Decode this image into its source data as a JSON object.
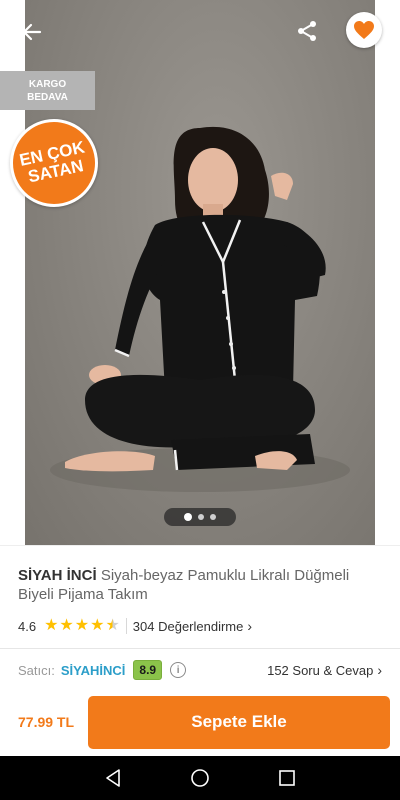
{
  "hero": {
    "cargo_badge": [
      "KARGO",
      "BEDAVA"
    ],
    "best_badge": [
      "EN ÇOK",
      "SATAN"
    ],
    "icons": [
      "back-arrow-icon",
      "share-icon",
      "heart-icon"
    ],
    "carousel": {
      "pages": 3,
      "active": 1
    }
  },
  "product": {
    "brand": "SİYAH İNCİ",
    "name": "Siyah-beyaz Pamuklu Likralı Düğmeli Biyeli Pijama Takım",
    "rating": "4.6",
    "rating_value": 4.6,
    "reviews": "304 Değerlendirme",
    "seller_label": "Satıcı:",
    "seller_name": "SİYAHİNCİ",
    "seller_score": "8.9",
    "qa": "152 Soru & Cevap"
  },
  "bottom": {
    "price": "77.99 TL",
    "cart_button": "Sepete Ekle"
  },
  "colors": {
    "accent": "#f27a1a",
    "seller": "#2c9ec9",
    "score": "#8bc34a",
    "star": "#ffc000"
  }
}
